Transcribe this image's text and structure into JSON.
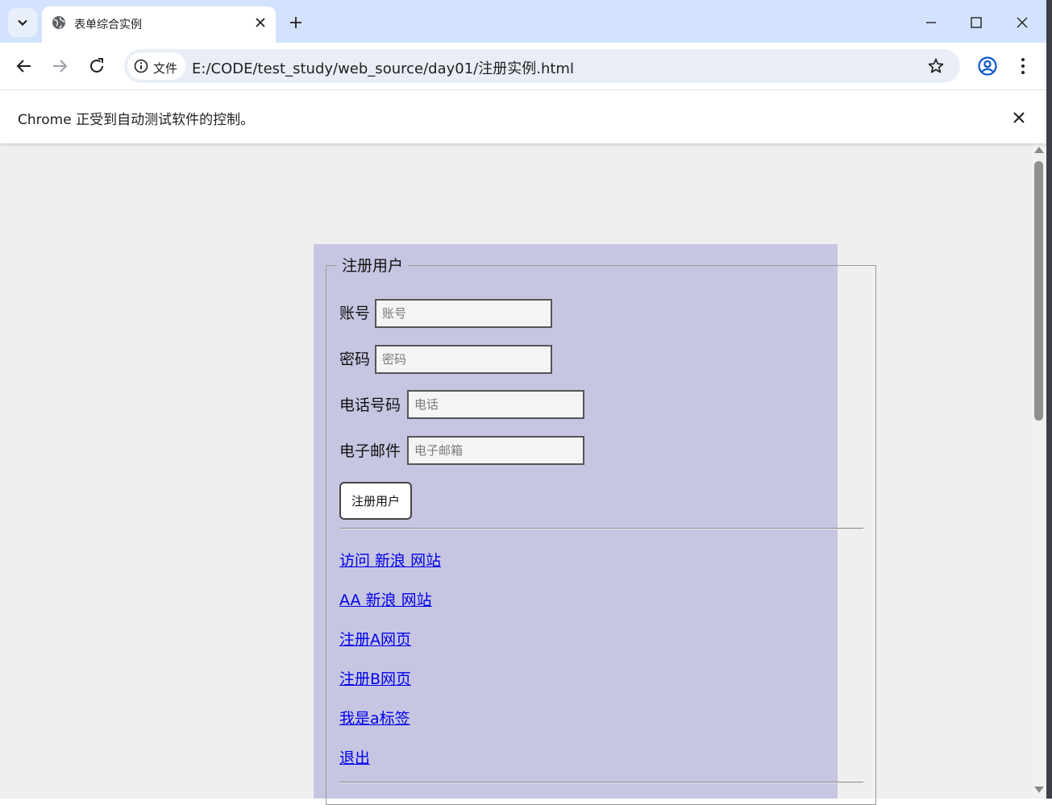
{
  "browser": {
    "tab": {
      "title": "表单综合实例"
    },
    "address": {
      "security_chip_label": "文件",
      "url": "E:/CODE/test_study/web_source/day01/注册实例.html"
    },
    "infobar": {
      "message": "Chrome 正受到自动测试软件的控制。"
    },
    "icons": [
      "tab-search-icon",
      "globe-icon",
      "close-icon",
      "plus-icon",
      "minimize-icon",
      "maximize-icon",
      "back-arrow-icon",
      "forward-arrow-icon",
      "reload-icon",
      "info-icon",
      "star-icon",
      "profile-icon",
      "more-vert-icon"
    ]
  },
  "page": {
    "background": "#efefef",
    "panel_color": "#c7c6e2",
    "link_color": "#0000ee",
    "form": {
      "legend": "注册用户",
      "fields": [
        {
          "label": "账号",
          "placeholder": "账号",
          "value": ""
        },
        {
          "label": "密码",
          "placeholder": "密码",
          "value": ""
        },
        {
          "label": "电话号码",
          "placeholder": "电话",
          "value": ""
        },
        {
          "label": "电子邮件",
          "placeholder": "电子邮箱",
          "value": ""
        }
      ],
      "submit_label": "注册用户"
    },
    "links": [
      "访问 新浪 网站",
      "AA 新浪 网站",
      "注册A网页",
      "注册B网页",
      "我是a标签",
      "退出"
    ]
  }
}
